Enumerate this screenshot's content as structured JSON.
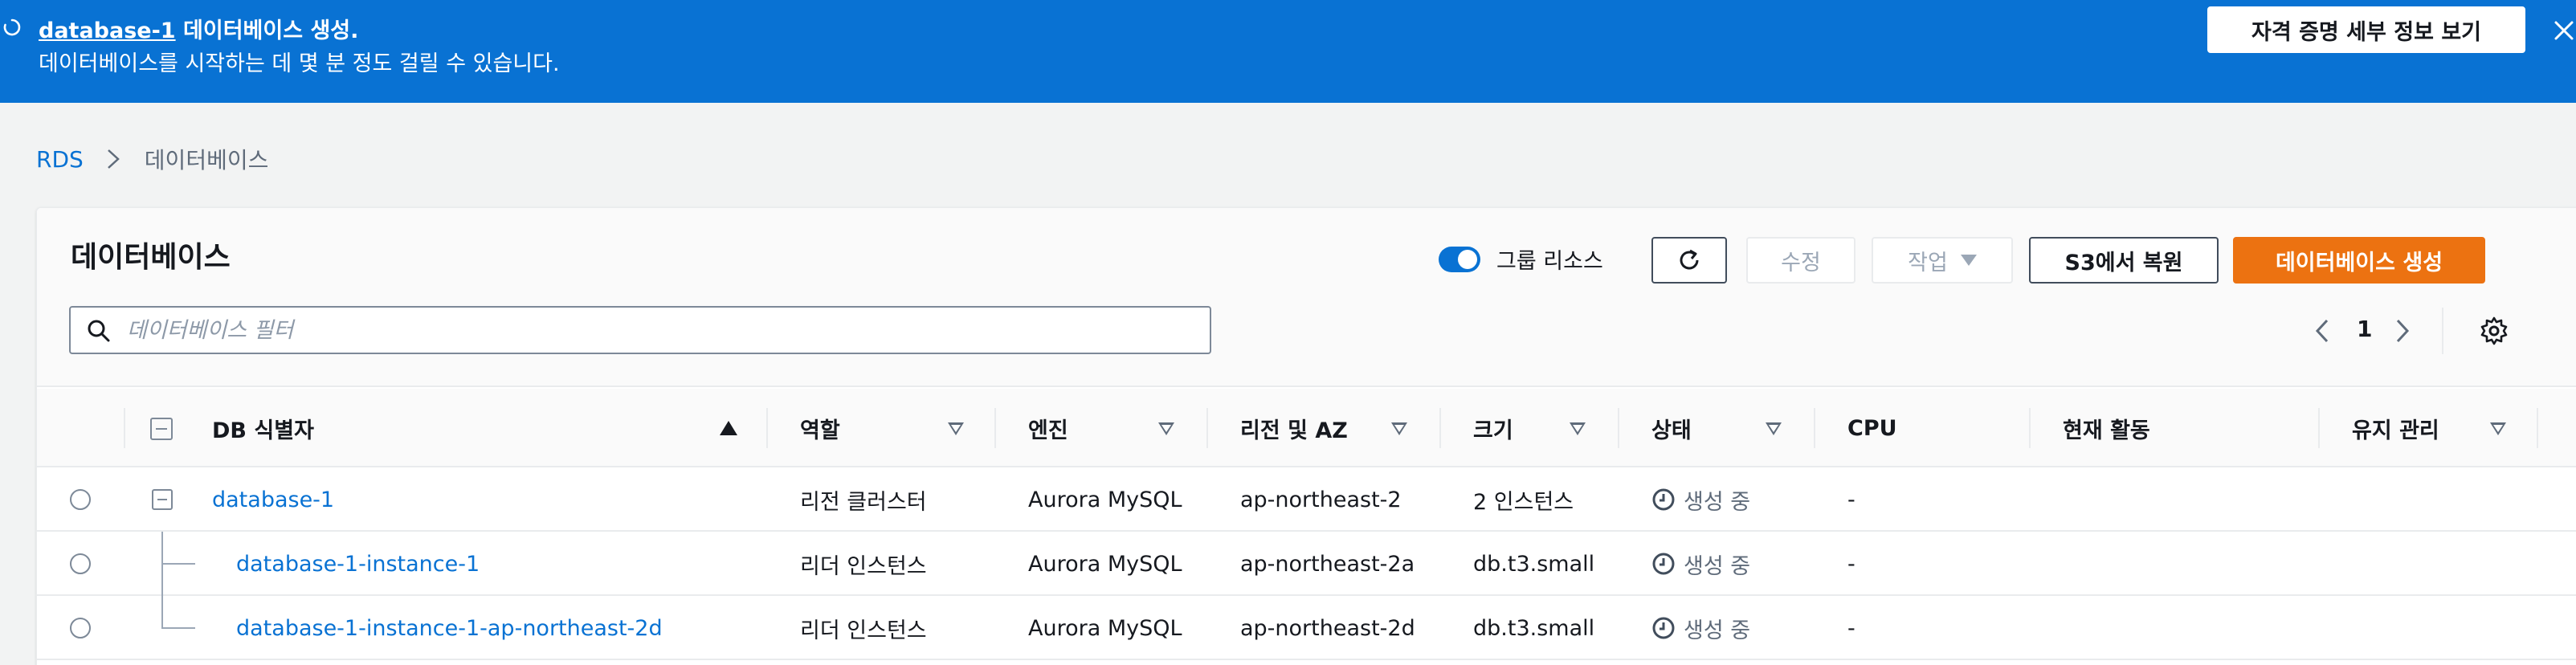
{
  "flash": {
    "resource_link": "database-1",
    "title_rest": " 데이터베이스 생성.",
    "subtitle": "데이터베이스를 시작하는 데 몇 분 정도 걸릴 수 있습니다.",
    "button_label": "자격 증명 세부 정보 보기",
    "color": "#0972d3"
  },
  "breadcrumb": {
    "root": "RDS",
    "current": "데이터베이스"
  },
  "panel": {
    "title": "데이터베이스",
    "group_toggle_label": "그룹 리소스",
    "group_toggle_on": true,
    "edit_label": "수정",
    "actions_label": "작업",
    "restore_label": "S3에서 복원",
    "create_label": "데이터베이스 생성",
    "accent": "#ec7211"
  },
  "search": {
    "placeholder": "데이터베이스 필터",
    "value": ""
  },
  "pagination": {
    "current_page": "1"
  },
  "table": {
    "columns": {
      "identifier": "DB 식별자",
      "role": "역할",
      "engine": "엔진",
      "region": "리전 및 AZ",
      "size": "크기",
      "status": "상태",
      "cpu": "CPU",
      "activity": "현재 활동",
      "maintenance": "유지 관리"
    },
    "rows": [
      {
        "identifier": "database-1",
        "role": "리전 클러스터",
        "engine": "Aurora MySQL",
        "region": "ap-northeast-2",
        "size": "2 인스턴스",
        "status": "생성 중",
        "cpu": "-"
      },
      {
        "identifier": "database-1-instance-1",
        "role": "리더 인스턴스",
        "engine": "Aurora MySQL",
        "region": "ap-northeast-2a",
        "size": "db.t3.small",
        "status": "생성 중",
        "cpu": "-"
      },
      {
        "identifier": "database-1-instance-1-ap-northeast-2d",
        "role": "리더 인스턴스",
        "engine": "Aurora MySQL",
        "region": "ap-northeast-2d",
        "size": "db.t3.small",
        "status": "생성 중",
        "cpu": "-"
      }
    ]
  }
}
